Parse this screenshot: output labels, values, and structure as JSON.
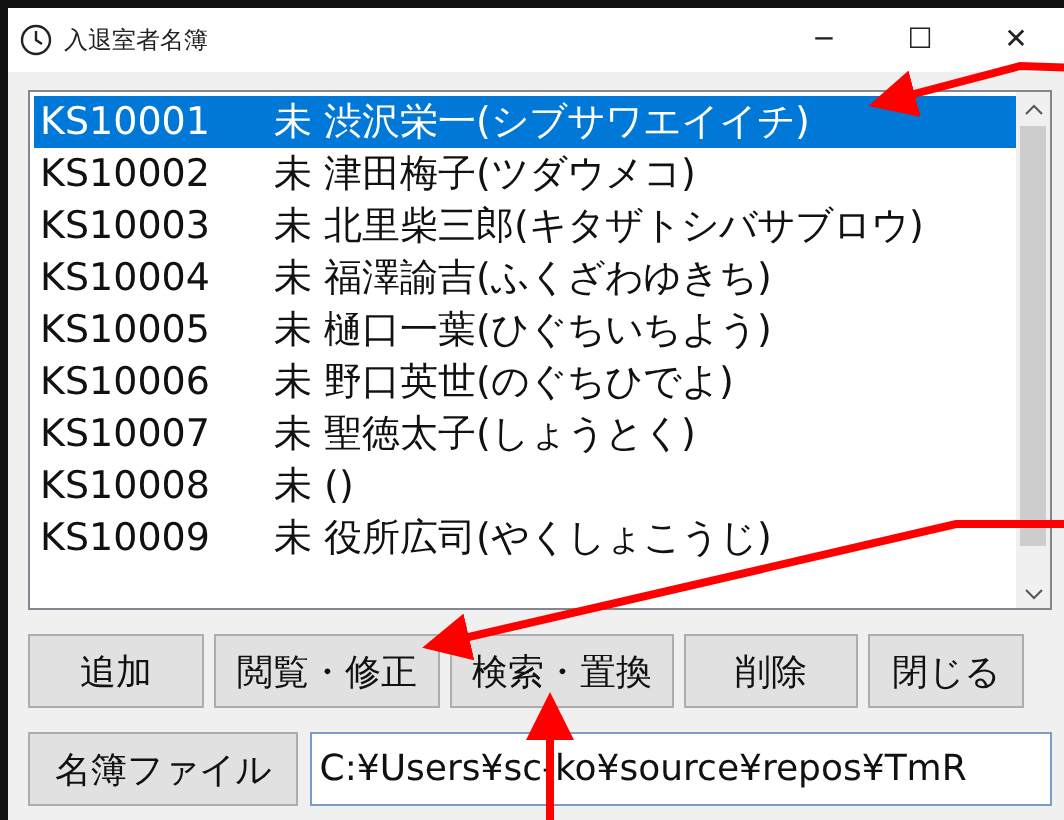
{
  "window": {
    "title": "入退室者名簿",
    "controls": [
      "─",
      "☐",
      "✕"
    ]
  },
  "list": {
    "rows": [
      {
        "id": "KS10001",
        "name": "未 渋沢栄一(シブサワエイイチ)",
        "selected": true
      },
      {
        "id": "KS10002",
        "name": "未 津田梅子(ツダウメコ)",
        "selected": false
      },
      {
        "id": "KS10003",
        "name": "未 北里柴三郎(キタザトシバサブロウ)",
        "selected": false
      },
      {
        "id": "KS10004",
        "name": "未 福澤諭吉(ふくざわゆきち)",
        "selected": false
      },
      {
        "id": "KS10005",
        "name": "未 樋口一葉(ひぐちいちよう)",
        "selected": false
      },
      {
        "id": "KS10006",
        "name": "未 野口英世(のぐちひでよ)",
        "selected": false
      },
      {
        "id": "KS10007",
        "name": "未 聖徳太子(しょうとく)",
        "selected": false
      },
      {
        "id": "KS10008",
        "name": "未 ()",
        "selected": false
      },
      {
        "id": "KS10009",
        "name": "未 役所広司(やくしょこうじ)",
        "selected": false
      }
    ]
  },
  "buttons": [
    "追加",
    "閲覧・修正",
    "検索・置換",
    "削除",
    "閉じる"
  ],
  "file": {
    "button": "名簿ファイル",
    "value": "C:¥Users¥sc-ko¥source¥repos¥TmR"
  }
}
